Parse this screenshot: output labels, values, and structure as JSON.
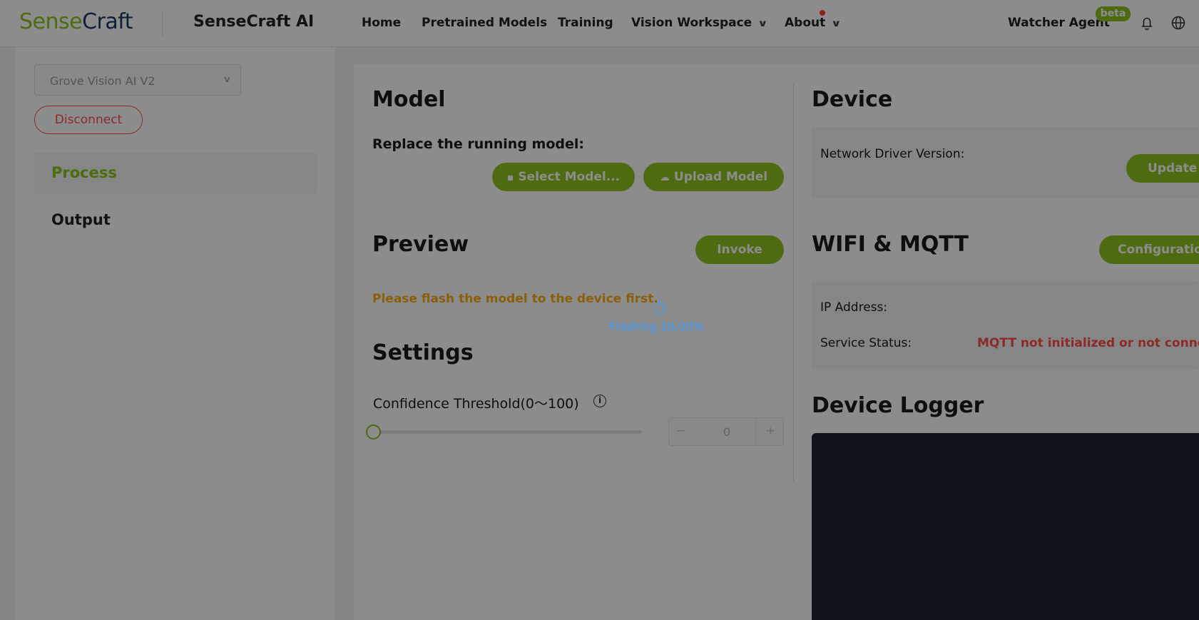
{
  "brand": {
    "logo_part1": "Sense",
    "logo_part2": "Craft",
    "app_title": "SenseCraft AI"
  },
  "nav": {
    "home": "Home",
    "pretrained": "Pretrained Models",
    "training": "Training",
    "vision_workspace": "Vision Workspace",
    "about": "About",
    "watcher_agent": "Watcher Agent",
    "beta_badge": "beta",
    "icons": [
      "bell-icon",
      "globe-icon"
    ]
  },
  "sidebar": {
    "device_select_value": "Grove Vision AI V2",
    "disconnect_label": "Disconnect",
    "items": [
      {
        "label": "Process",
        "active": true
      },
      {
        "label": "Output",
        "active": false
      }
    ]
  },
  "model": {
    "title": "Model",
    "replace_label": "Replace the running model:",
    "select_button": "Select Model...",
    "upload_button": "Upload Model"
  },
  "preview": {
    "title": "Preview",
    "invoke_button": "Invoke",
    "warning": "Please flash the model to the device first."
  },
  "settings": {
    "title": "Settings",
    "confidence_label": "Confidence Threshold(0～100)",
    "confidence_value": "0",
    "stepper_minus": "−",
    "stepper_plus": "+"
  },
  "device": {
    "title": "Device",
    "network_driver_label": "Network Driver Version:",
    "update_button": "Update"
  },
  "wifi": {
    "title": "WIFI & MQTT",
    "config_button": "Configuration",
    "ip_label": "IP Address:",
    "service_label": "Service Status:",
    "service_value": "MQTT not initialized or not connected"
  },
  "logger": {
    "title": "Device Logger"
  },
  "overlay": {
    "flashing_text": "Flashing 16.00%",
    "progress": 16.0
  },
  "colors": {
    "accent": "#8fc31f",
    "danger": "#ff4d4f",
    "warning": "#faad14",
    "spinner": "#3a9fff",
    "logger_bg": "#1b2333"
  }
}
